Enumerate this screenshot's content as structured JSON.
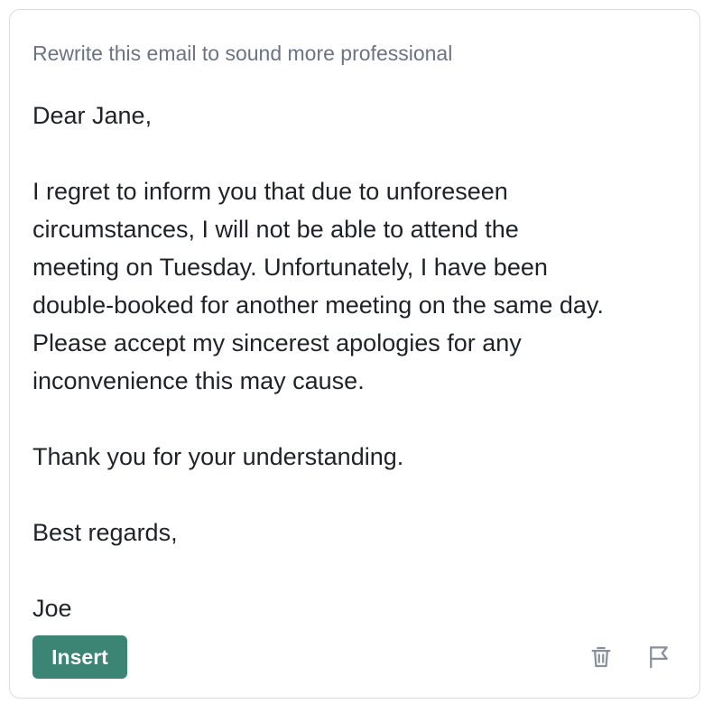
{
  "card": {
    "prompt": "Rewrite this email to sound more professional",
    "email": {
      "greeting": "Dear Jane,",
      "paragraph_lines": [
        "I regret to inform you that due to unforeseen",
        "circumstances, I will not be able to attend the",
        "meeting on Tuesday. Unfortunately, I have been",
        "double-booked for another meeting on the same day.",
        "Please accept my sincerest apologies for any",
        "inconvenience this may cause."
      ],
      "thanks": "Thank you for your understanding.",
      "closing": "Best regards,",
      "signature": "Joe"
    },
    "actions": {
      "insert_label": "Insert",
      "delete_icon": "trash-icon",
      "flag_icon": "flag-icon"
    }
  },
  "colors": {
    "accent": "#3c8474",
    "prompt_text": "#6c7382",
    "body_text": "#1f2329",
    "icon": "#8a909b",
    "border": "#d9dce1"
  }
}
